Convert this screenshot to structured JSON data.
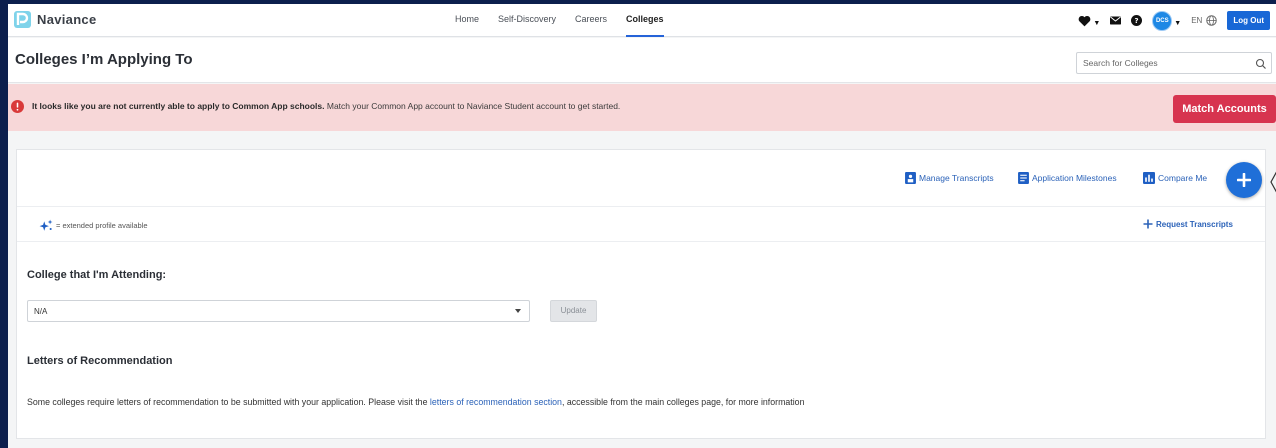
{
  "app": {
    "name": "Naviance",
    "brand_color": "#1867d6"
  },
  "nav": {
    "links": [
      {
        "label": "Home",
        "active": false
      },
      {
        "label": "Self-Discovery",
        "active": false
      },
      {
        "label": "Careers",
        "active": false
      },
      {
        "label": "Colleges",
        "active": true
      }
    ],
    "avatar_initials": "DCS",
    "language": "EN",
    "logout_label": "Log Out",
    "icons": [
      "heart-icon",
      "mail-icon",
      "help-icon",
      "globe-icon"
    ]
  },
  "page": {
    "title": "Colleges I’m Applying To",
    "search_placeholder": "Search for Colleges"
  },
  "alert": {
    "bold_text": "It looks like you are not currently able to apply to Common App schools.",
    "text": " Match your Common App account to Naviance Student account to get started.",
    "button_label": "Match Accounts",
    "color": "#d7344f"
  },
  "toolbar": {
    "manage_transcripts": "Manage Transcripts",
    "application_milestones": "Application Milestones",
    "compare_me": "Compare Me"
  },
  "legend": {
    "text": "= extended profile available",
    "request_transcripts": "Request Transcripts"
  },
  "attending": {
    "title": "College that I'm Attending:",
    "selected": "N/A",
    "update_label": "Update"
  },
  "recommendations": {
    "title": "Letters of Recommendation",
    "text_before": "Some colleges require letters of recommendation to be submitted with your application. Please visit the ",
    "link": "letters of recommendation section",
    "text_after": ", accessible from the main colleges page, for more information"
  }
}
